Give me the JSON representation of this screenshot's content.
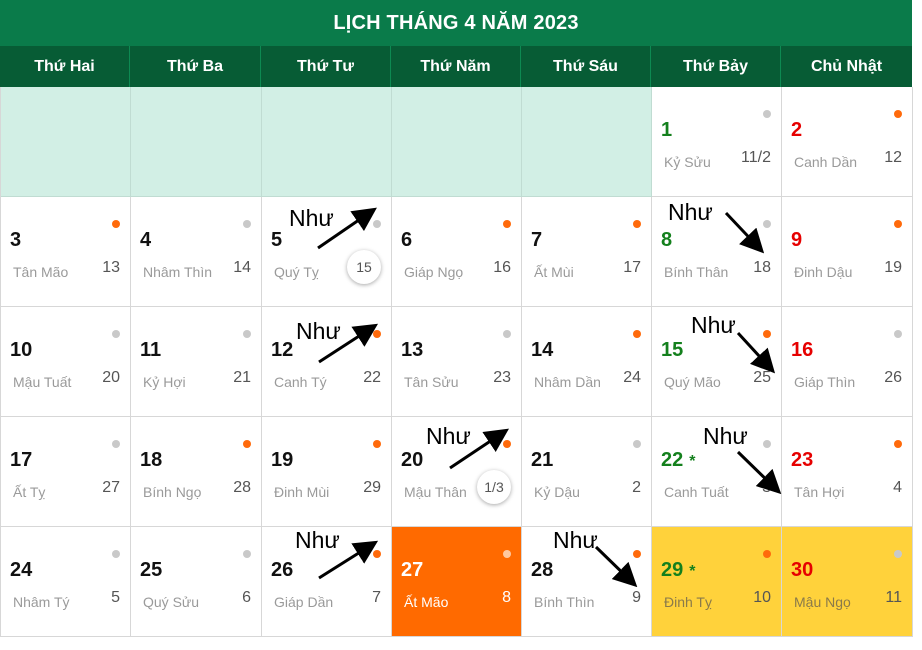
{
  "title": "LỊCH THÁNG 4 NĂM 2023",
  "weekdays": [
    "Thứ Hai",
    "Thứ Ba",
    "Thứ Tư",
    "Thứ Năm",
    "Thứ Sáu",
    "Thứ Bảy",
    "Chủ Nhật"
  ],
  "days": [
    {
      "solar": "1",
      "canchi": "Kỷ Sửu",
      "lunar": "11/2",
      "dot": "grey",
      "day_color": "green"
    },
    {
      "solar": "2",
      "canchi": "Canh Dần",
      "lunar": "12",
      "dot": "orange",
      "day_color": "red"
    },
    {
      "solar": "3",
      "canchi": "Tân Mão",
      "lunar": "13",
      "dot": "orange",
      "day_color": "black"
    },
    {
      "solar": "4",
      "canchi": "Nhâm Thìn",
      "lunar": "14",
      "dot": "grey",
      "day_color": "black"
    },
    {
      "solar": "5",
      "canchi": "Quý Tỵ",
      "lunar": "15",
      "dot": "grey",
      "day_color": "black",
      "lunar_circled": true
    },
    {
      "solar": "6",
      "canchi": "Giáp Ngọ",
      "lunar": "16",
      "dot": "orange",
      "day_color": "black"
    },
    {
      "solar": "7",
      "canchi": "Ất Mùi",
      "lunar": "17",
      "dot": "orange",
      "day_color": "black"
    },
    {
      "solar": "8",
      "canchi": "Bính Thân",
      "lunar": "18",
      "dot": "grey",
      "day_color": "green"
    },
    {
      "solar": "9",
      "canchi": "Đinh Dậu",
      "lunar": "19",
      "dot": "orange",
      "day_color": "red"
    },
    {
      "solar": "10",
      "canchi": "Mậu Tuất",
      "lunar": "20",
      "dot": "grey",
      "day_color": "black"
    },
    {
      "solar": "11",
      "canchi": "Kỷ Hợi",
      "lunar": "21",
      "dot": "grey",
      "day_color": "black"
    },
    {
      "solar": "12",
      "canchi": "Canh Tý",
      "lunar": "22",
      "dot": "orange",
      "day_color": "black"
    },
    {
      "solar": "13",
      "canchi": "Tân Sửu",
      "lunar": "23",
      "dot": "grey",
      "day_color": "black"
    },
    {
      "solar": "14",
      "canchi": "Nhâm Dần",
      "lunar": "24",
      "dot": "orange",
      "day_color": "black"
    },
    {
      "solar": "15",
      "canchi": "Quý Mão",
      "lunar": "25",
      "dot": "orange",
      "day_color": "green"
    },
    {
      "solar": "16",
      "canchi": "Giáp Thìn",
      "lunar": "26",
      "dot": "grey",
      "day_color": "red"
    },
    {
      "solar": "17",
      "canchi": "Ất Tỵ",
      "lunar": "27",
      "dot": "grey",
      "day_color": "black"
    },
    {
      "solar": "18",
      "canchi": "Bính Ngọ",
      "lunar": "28",
      "dot": "orange",
      "day_color": "black"
    },
    {
      "solar": "19",
      "canchi": "Đinh Mùi",
      "lunar": "29",
      "dot": "orange",
      "day_color": "black"
    },
    {
      "solar": "20",
      "canchi": "Mậu Thân",
      "lunar": "1/3",
      "dot": "orange",
      "day_color": "black",
      "lunar_circled": true
    },
    {
      "solar": "21",
      "canchi": "Kỷ Dậu",
      "lunar": "2",
      "dot": "grey",
      "day_color": "black"
    },
    {
      "solar": "22",
      "canchi": "Canh Tuất",
      "lunar": "3",
      "dot": "grey",
      "day_color": "green",
      "star": "*"
    },
    {
      "solar": "23",
      "canchi": "Tân Hợi",
      "lunar": "4",
      "dot": "orange",
      "day_color": "red"
    },
    {
      "solar": "24",
      "canchi": "Nhâm Tý",
      "lunar": "5",
      "dot": "grey",
      "day_color": "black"
    },
    {
      "solar": "25",
      "canchi": "Quý Sửu",
      "lunar": "6",
      "dot": "grey",
      "day_color": "black"
    },
    {
      "solar": "26",
      "canchi": "Giáp Dần",
      "lunar": "7",
      "dot": "orange",
      "day_color": "black"
    },
    {
      "solar": "27",
      "canchi": "Ất Mão",
      "lunar": "8",
      "dot": "grey",
      "day_color": "white",
      "today": true
    },
    {
      "solar": "28",
      "canchi": "Bính Thìn",
      "lunar": "9",
      "dot": "orange",
      "day_color": "black"
    },
    {
      "solar": "29",
      "canchi": "Đinh Tỵ",
      "lunar": "10",
      "dot": "orange",
      "day_color": "green",
      "star": "*",
      "special": true
    },
    {
      "solar": "30",
      "canchi": "Mậu Ngọ",
      "lunar": "11",
      "dot": "grey",
      "day_color": "red",
      "special": true
    }
  ],
  "annotation_text": "Như",
  "colors": {
    "title_bg": "#0a7b4a",
    "header_bg": "#075c35",
    "empty_cell": "#d2efe5",
    "today": "#ff6a00",
    "special": "#ffd23b",
    "weekend_red": "#e60000",
    "good_green": "#14801d"
  }
}
